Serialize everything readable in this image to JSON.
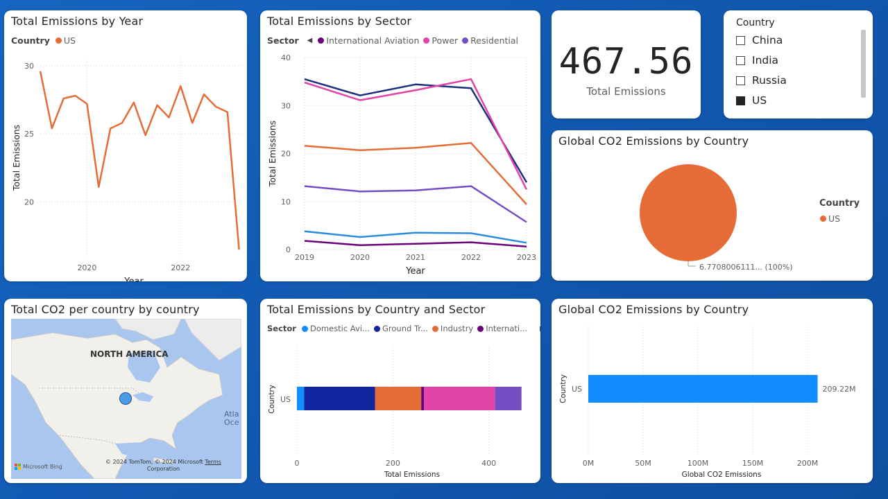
{
  "cards": {
    "emissions_by_year": {
      "title": "Total Emissions by Year",
      "legend_title": "Country",
      "legend_items": [
        {
          "label": "US",
          "color": "#e66c37"
        }
      ],
      "xlabel": "Year",
      "ylabel": "Total Emissions",
      "x_ticks": [
        "2020",
        "2022"
      ],
      "y_ticks": [
        "30",
        "25",
        "20"
      ]
    },
    "emissions_by_sector": {
      "title": "Total Emissions by Sector",
      "legend_title": "Sector",
      "legend_items": [
        {
          "label": "International Aviation",
          "color": "#6b007b"
        },
        {
          "label": "Power",
          "color": "#e044a7"
        },
        {
          "label": "Residential",
          "color": "#744ec2"
        }
      ],
      "xlabel": "Year",
      "ylabel": "Total Emissions",
      "x_ticks": [
        "2019",
        "2020",
        "2021",
        "2022",
        "2023"
      ],
      "y_ticks": [
        "40",
        "30",
        "20",
        "10",
        "0"
      ]
    },
    "kpi": {
      "value": "467.56",
      "label": "Total Emissions"
    },
    "slicer": {
      "title": "Country",
      "items": [
        {
          "label": "China",
          "checked": false
        },
        {
          "label": "India",
          "checked": false
        },
        {
          "label": "Russia",
          "checked": false
        },
        {
          "label": "US",
          "checked": true
        }
      ]
    },
    "pie": {
      "title": "Global CO2 Emissions by Country",
      "legend_title": "Country",
      "legend_items": [
        {
          "label": "US",
          "color": "#e66c37"
        }
      ],
      "slice_label": "6.7708006111... (100%)"
    },
    "map": {
      "title": "Total CO2 per country by country",
      "region_label": "NORTH AMERICA",
      "ocean_label_1": "Atla",
      "ocean_label_2": "Oce",
      "brand": "Microsoft Bing",
      "copyright": "© 2024 TomTom, © 2024 Microsoft",
      "copyright_2": "Corporation",
      "terms": "Terms",
      "bubble_color": "#4a9be8"
    },
    "country_sector": {
      "title": "Total Emissions by Country and Sector",
      "legend_title": "Sector",
      "legend_items": [
        {
          "label": "Domestic Avi...",
          "color": "#118dff"
        },
        {
          "label": "Ground Tr...",
          "color": "#12239e"
        },
        {
          "label": "Industry",
          "color": "#e66c37"
        },
        {
          "label": "Internati...",
          "color": "#6b007b"
        }
      ],
      "ylabel": "Country",
      "xlabel": "Total Emissions",
      "category": "US",
      "x_ticks": [
        "0",
        "200",
        "400"
      ]
    },
    "bar_country": {
      "title": "Global CO2 Emissions by Country",
      "ylabel": "Country",
      "xlabel": "Global CO2 Emissions",
      "category": "US",
      "value_label": "209.22M",
      "x_ticks": [
        "0M",
        "50M",
        "100M",
        "150M",
        "200M"
      ]
    }
  },
  "colors": {
    "orange": "#e66c37",
    "navy": "#12239e",
    "pink": "#e044a7",
    "purple": "#744ec2",
    "blue": "#118dff",
    "light_blue": "#2b8ae0",
    "dark_purple": "#6b007b",
    "dark_navy": "#1b2f7d"
  },
  "chart_data": [
    {
      "type": "line",
      "title": "Total Emissions by Year",
      "xlabel": "Year",
      "ylabel": "Total Emissions",
      "ylim": [
        16,
        30.5
      ],
      "x_range": [
        2019,
        2023.3
      ],
      "series": [
        {
          "name": "US",
          "color": "#e66c37",
          "x": [
            2019.0,
            2019.25,
            2019.5,
            2019.75,
            2020.0,
            2020.25,
            2020.5,
            2020.75,
            2021.0,
            2021.25,
            2021.5,
            2021.75,
            2022.0,
            2022.25,
            2022.5,
            2022.75,
            2023.0,
            2023.25
          ],
          "y": [
            29.6,
            25.4,
            27.6,
            27.8,
            27.2,
            21.1,
            25.4,
            25.8,
            27.3,
            24.9,
            27.1,
            26.2,
            28.5,
            25.8,
            27.9,
            27.0,
            26.6,
            16.5
          ]
        }
      ]
    },
    {
      "type": "line",
      "title": "Total Emissions by Sector",
      "xlabel": "Year",
      "ylabel": "Total Emissions",
      "ylim": [
        0,
        40
      ],
      "x": [
        2019,
        2020,
        2021,
        2022,
        2023
      ],
      "series": [
        {
          "color": "#1b2f7d",
          "values": [
            35.5,
            32.1,
            34.4,
            33.6,
            14.0
          ]
        },
        {
          "name": "Power",
          "color": "#e044a7",
          "values": [
            34.8,
            31.1,
            33.2,
            35.5,
            12.5
          ]
        },
        {
          "color": "#e66c37",
          "values": [
            21.6,
            20.7,
            21.2,
            22.2,
            9.4
          ]
        },
        {
          "name": "Residential",
          "color": "#744ec2",
          "values": [
            13.2,
            12.1,
            12.3,
            13.2,
            5.7
          ]
        },
        {
          "color": "#2b8ae0",
          "values": [
            3.8,
            2.6,
            3.5,
            3.4,
            1.4
          ]
        },
        {
          "name": "International Aviation",
          "color": "#6b007b",
          "values": [
            1.8,
            0.9,
            1.2,
            1.5,
            0.6
          ]
        }
      ]
    },
    {
      "type": "pie",
      "title": "Global CO2 Emissions by Country",
      "categories": [
        "US"
      ],
      "values": [
        100
      ],
      "colors": [
        "#e66c37"
      ]
    },
    {
      "type": "bar",
      "title": "Total Emissions by Country and Sector",
      "orientation": "horizontal",
      "stacked": true,
      "categories": [
        "US"
      ],
      "xlim": [
        0,
        480
      ],
      "series": [
        {
          "name": "Domestic Avi...",
          "color": "#118dff",
          "values": [
            15
          ]
        },
        {
          "name": "Ground Tr...",
          "color": "#12239e",
          "values": [
            148
          ]
        },
        {
          "name": "Industry",
          "color": "#e66c37",
          "values": [
            96
          ]
        },
        {
          "name": "Internati...",
          "color": "#6b007b",
          "values": [
            6
          ]
        },
        {
          "color": "#e044a7",
          "values": [
            148
          ]
        },
        {
          "color": "#744ec2",
          "values": [
            55
          ]
        }
      ]
    },
    {
      "type": "bar",
      "title": "Global CO2 Emissions by Country",
      "orientation": "horizontal",
      "categories": [
        "US"
      ],
      "values": [
        209.22
      ],
      "xlim": [
        0,
        210
      ],
      "color": "#118dff"
    }
  ]
}
